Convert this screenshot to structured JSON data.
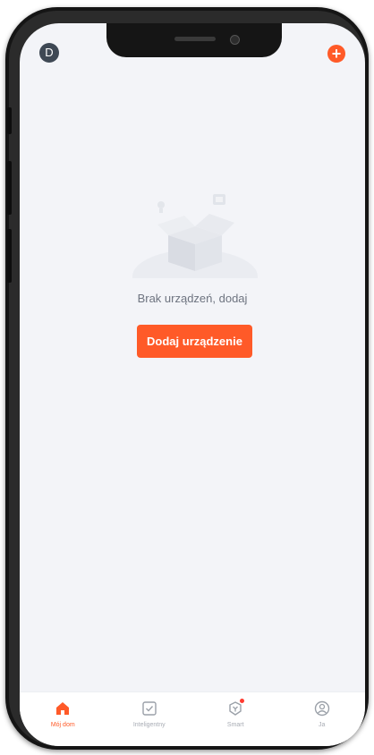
{
  "header": {
    "avatar_initial": "D",
    "add_icon": "plus-icon"
  },
  "empty_state": {
    "icon": "empty-box-icon",
    "message": "Brak urządzeń, dodaj",
    "button_label": "Dodaj urządzenie"
  },
  "bottom_nav": {
    "items": [
      {
        "label": "Mój dom",
        "icon": "home-icon",
        "active": true
      },
      {
        "label": "Inteligentny",
        "icon": "checkbox-icon",
        "active": false
      },
      {
        "label": "Smart",
        "icon": "smart-shield-icon",
        "active": false,
        "badge": true
      },
      {
        "label": "Ja",
        "icon": "profile-icon",
        "active": false
      }
    ]
  },
  "colors": {
    "accent": "#ff5a28",
    "screen_bg": "#f3f4f8",
    "avatar_bg": "#3e4854",
    "inactive": "#a8acb4",
    "badge": "#ff3b30"
  }
}
